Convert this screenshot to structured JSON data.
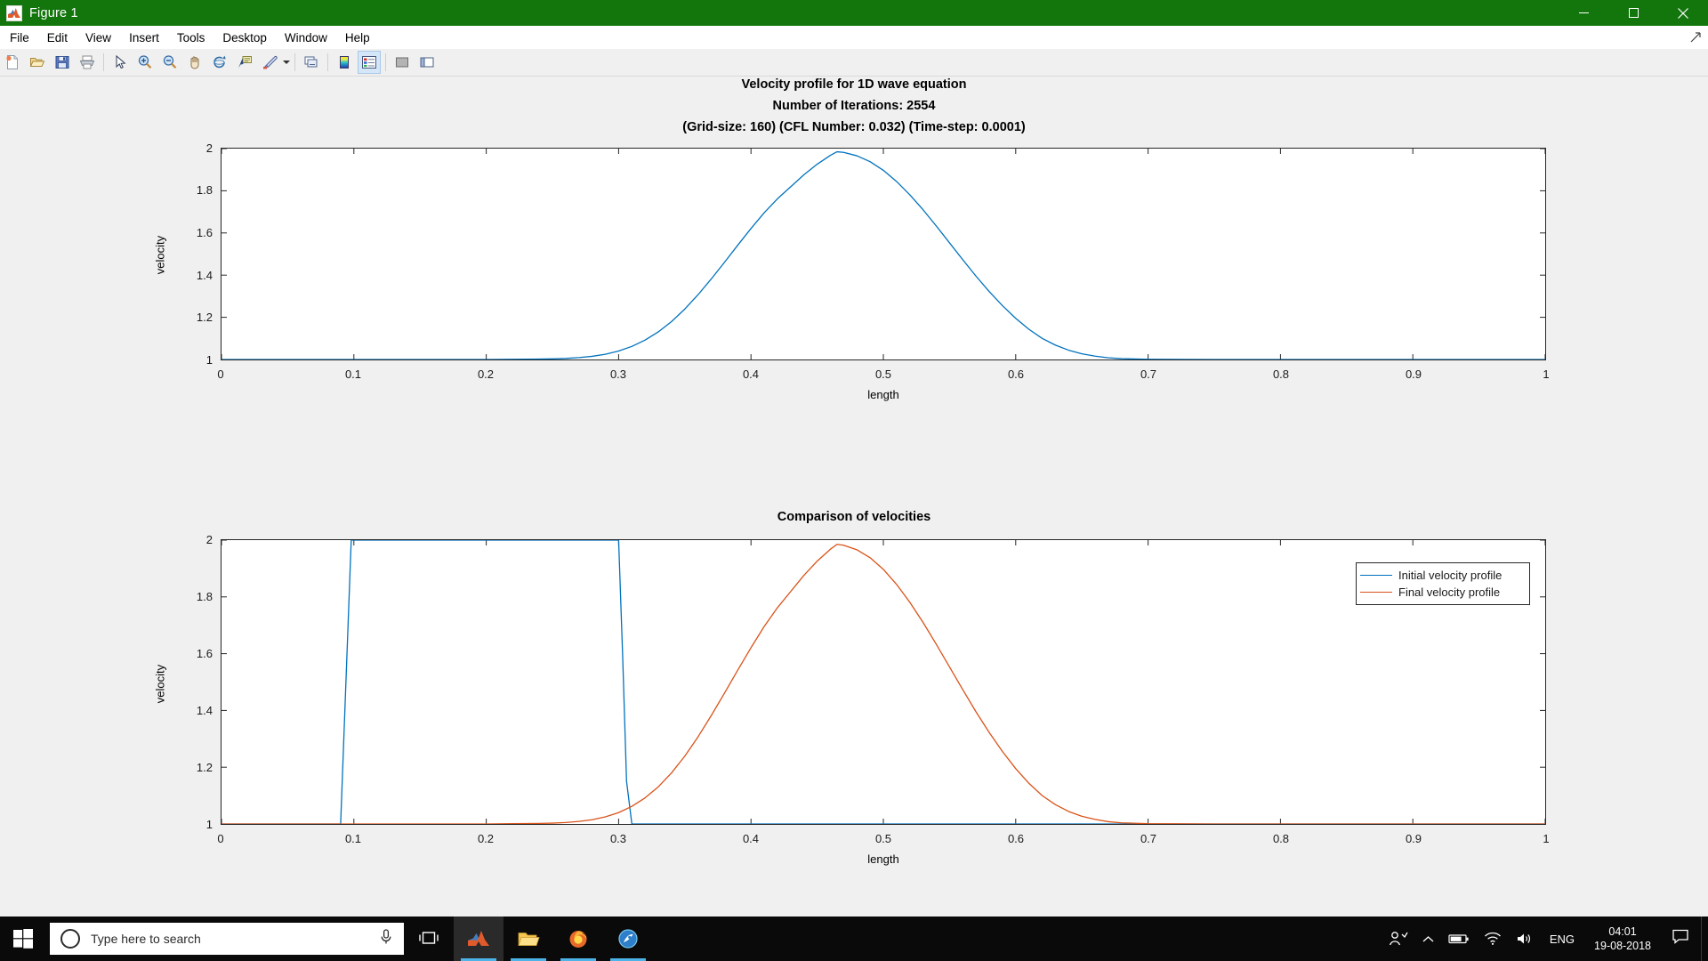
{
  "window": {
    "title": "Figure 1",
    "app_icon": "matlab-icon",
    "controls": {
      "minimize": "minimize-icon",
      "maximize": "maximize-icon",
      "close": "close-icon"
    },
    "titlebar_color": "#13760d"
  },
  "menubar": {
    "items": [
      {
        "label": "File"
      },
      {
        "label": "Edit"
      },
      {
        "label": "View"
      },
      {
        "label": "Insert"
      },
      {
        "label": "Tools"
      },
      {
        "label": "Desktop"
      },
      {
        "label": "Window"
      },
      {
        "label": "Help"
      }
    ]
  },
  "toolbar": {
    "items": [
      {
        "name": "new-figure-icon",
        "tooltip": "New Figure"
      },
      {
        "name": "open-file-icon",
        "tooltip": "Open File"
      },
      {
        "name": "save-figure-icon",
        "tooltip": "Save Figure"
      },
      {
        "name": "print-figure-icon",
        "tooltip": "Print Figure"
      },
      {
        "name": "separator"
      },
      {
        "name": "pointer-icon",
        "tooltip": "Edit Plot"
      },
      {
        "name": "zoom-in-icon",
        "tooltip": "Zoom In"
      },
      {
        "name": "zoom-out-icon",
        "tooltip": "Zoom Out"
      },
      {
        "name": "pan-icon",
        "tooltip": "Pan"
      },
      {
        "name": "rotate-3d-icon",
        "tooltip": "Rotate 3D"
      },
      {
        "name": "data-cursor-icon",
        "tooltip": "Data Cursor"
      },
      {
        "name": "brush-icon",
        "tooltip": "Brush/Select Data"
      },
      {
        "name": "brush-dropdown-arrow-icon",
        "tooltip": "Brush options"
      },
      {
        "name": "separator"
      },
      {
        "name": "link-plot-icon",
        "tooltip": "Link Plot"
      },
      {
        "name": "separator"
      },
      {
        "name": "colorbar-icon",
        "tooltip": "Insert Colorbar"
      },
      {
        "name": "legend-icon",
        "tooltip": "Insert Legend",
        "active": true
      },
      {
        "name": "separator"
      },
      {
        "name": "hide-plot-tools-icon",
        "tooltip": "Hide Plot Tools"
      },
      {
        "name": "show-plot-tools-icon",
        "tooltip": "Show Plot Tools and Dock Figure"
      }
    ]
  },
  "chart_data": [
    {
      "id": "top",
      "type": "line",
      "title": "Velocity profile for 1D wave equation",
      "subtitle": "Number of Iterations: 2554",
      "subtitle2": "(Grid-size: 160) (CFL Number: 0.032) (Time-step: 0.0001)",
      "xlabel": "length",
      "ylabel": "velocity",
      "xlim": [
        0,
        1
      ],
      "ylim": [
        1,
        2
      ],
      "xticks": [
        "0",
        "0.1",
        "0.2",
        "0.3",
        "0.4",
        "0.5",
        "0.6",
        "0.7",
        "0.8",
        "0.9",
        "1"
      ],
      "xtick_values": [
        0,
        0.1,
        0.2,
        0.3,
        0.4,
        0.5,
        0.6,
        0.7,
        0.8,
        0.9,
        1
      ],
      "yticks": [
        "1",
        "1.2",
        "1.4",
        "1.6",
        "1.8",
        "2"
      ],
      "ytick_values": [
        1,
        1.2,
        1.4,
        1.6,
        1.8,
        2
      ],
      "grid": false,
      "legend": null,
      "series": [
        {
          "name": "Final velocity profile",
          "color": "#0072bd",
          "comment": "smeared/diffused travelling bump, base 1, peak ~1.985 near x=0.465",
          "x": [
            0.0,
            0.05,
            0.1,
            0.15,
            0.2,
            0.22,
            0.24,
            0.25,
            0.26,
            0.27,
            0.28,
            0.29,
            0.3,
            0.31,
            0.32,
            0.33,
            0.34,
            0.35,
            0.36,
            0.37,
            0.38,
            0.39,
            0.4,
            0.41,
            0.42,
            0.43,
            0.44,
            0.45,
            0.46,
            0.465,
            0.47,
            0.48,
            0.49,
            0.5,
            0.51,
            0.52,
            0.53,
            0.54,
            0.55,
            0.56,
            0.57,
            0.58,
            0.59,
            0.6,
            0.61,
            0.62,
            0.63,
            0.64,
            0.65,
            0.66,
            0.67,
            0.68,
            0.7,
            0.75,
            0.8,
            0.9,
            1.0
          ],
          "y": [
            1.0,
            1.0,
            1.0,
            1.0,
            1.0,
            1.001,
            1.002,
            1.003,
            1.005,
            1.009,
            1.015,
            1.025,
            1.04,
            1.062,
            1.092,
            1.131,
            1.18,
            1.239,
            1.307,
            1.382,
            1.461,
            1.542,
            1.621,
            1.696,
            1.762,
            1.819,
            1.876,
            1.926,
            1.968,
            1.985,
            1.982,
            1.966,
            1.938,
            1.897,
            1.844,
            1.781,
            1.71,
            1.633,
            1.553,
            1.473,
            1.395,
            1.322,
            1.255,
            1.195,
            1.143,
            1.1,
            1.068,
            1.044,
            1.027,
            1.016,
            1.008,
            1.004,
            1.001,
            1.0,
            1.0,
            1.0,
            1.0
          ]
        }
      ]
    },
    {
      "id": "bottom",
      "type": "line",
      "title": "Comparison of velocities",
      "xlabel": "length",
      "ylabel": "velocity",
      "xlim": [
        0,
        1
      ],
      "ylim": [
        1,
        2
      ],
      "xticks": [
        "0",
        "0.1",
        "0.2",
        "0.3",
        "0.4",
        "0.5",
        "0.6",
        "0.7",
        "0.8",
        "0.9",
        "1"
      ],
      "xtick_values": [
        0,
        0.1,
        0.2,
        0.3,
        0.4,
        0.5,
        0.6,
        0.7,
        0.8,
        0.9,
        1
      ],
      "yticks": [
        "1",
        "1.2",
        "1.4",
        "1.6",
        "1.8",
        "2"
      ],
      "ytick_values": [
        1,
        1.2,
        1.4,
        1.6,
        1.8,
        2
      ],
      "grid": false,
      "legend": {
        "position": "northeast",
        "entries": [
          {
            "label": "Initial velocity profile",
            "color": "#0072bd"
          },
          {
            "label": "Final velocity profile",
            "color": "#d95319"
          }
        ]
      },
      "series": [
        {
          "name": "Initial velocity profile",
          "color": "#0072bd",
          "comment": "square wave: value 2 between x=0.094 and x=0.306, else 1",
          "x": [
            0.0,
            0.09,
            0.094,
            0.098,
            0.3,
            0.303,
            0.306,
            0.31,
            1.0
          ],
          "y": [
            1.0,
            1.0,
            1.5,
            2.0,
            2.0,
            1.6,
            1.15,
            1.0,
            1.0
          ]
        },
        {
          "name": "Final velocity profile",
          "color": "#d95319",
          "comment": "same smeared bump as top plot",
          "x": [
            0.0,
            0.05,
            0.1,
            0.15,
            0.2,
            0.22,
            0.24,
            0.25,
            0.26,
            0.27,
            0.28,
            0.29,
            0.3,
            0.31,
            0.32,
            0.33,
            0.34,
            0.35,
            0.36,
            0.37,
            0.38,
            0.39,
            0.4,
            0.41,
            0.42,
            0.43,
            0.44,
            0.45,
            0.46,
            0.465,
            0.47,
            0.48,
            0.49,
            0.5,
            0.51,
            0.52,
            0.53,
            0.54,
            0.55,
            0.56,
            0.57,
            0.58,
            0.59,
            0.6,
            0.61,
            0.62,
            0.63,
            0.64,
            0.65,
            0.66,
            0.67,
            0.68,
            0.7,
            0.75,
            0.8,
            0.9,
            1.0
          ],
          "y": [
            1.0,
            1.0,
            1.0,
            1.0,
            1.0,
            1.001,
            1.002,
            1.003,
            1.005,
            1.009,
            1.015,
            1.025,
            1.04,
            1.062,
            1.092,
            1.131,
            1.18,
            1.239,
            1.307,
            1.382,
            1.461,
            1.542,
            1.621,
            1.696,
            1.762,
            1.819,
            1.876,
            1.926,
            1.968,
            1.985,
            1.982,
            1.966,
            1.938,
            1.897,
            1.844,
            1.781,
            1.71,
            1.633,
            1.553,
            1.473,
            1.395,
            1.322,
            1.255,
            1.195,
            1.143,
            1.1,
            1.068,
            1.044,
            1.027,
            1.016,
            1.008,
            1.004,
            1.001,
            1.0,
            1.0,
            1.0,
            1.0
          ]
        }
      ]
    }
  ],
  "taskbar": {
    "start": "windows-start-icon",
    "search": {
      "placeholder": "Type here to search",
      "icon": "search-circle-icon",
      "mic_icon": "microphone-icon"
    },
    "tasks": [
      {
        "name": "task-view-icon",
        "label": "Task View"
      },
      {
        "name": "matlab-taskbar-icon",
        "label": "MATLAB",
        "open": true,
        "active": true
      },
      {
        "name": "file-explorer-icon",
        "label": "File Explorer",
        "open": true
      },
      {
        "name": "firefox-icon",
        "label": "Firefox",
        "open": true
      },
      {
        "name": "app-icon",
        "label": "Application",
        "open": true
      }
    ],
    "tray": {
      "people_icon": "people-icon",
      "chevron_icon": "chevron-up-icon",
      "battery_icon": "battery-icon",
      "network_icon": "wifi-icon",
      "volume_icon": "speaker-icon",
      "language": "ENG",
      "time": "04:01",
      "date": "19-08-2018",
      "action_center_icon": "action-center-icon"
    }
  }
}
